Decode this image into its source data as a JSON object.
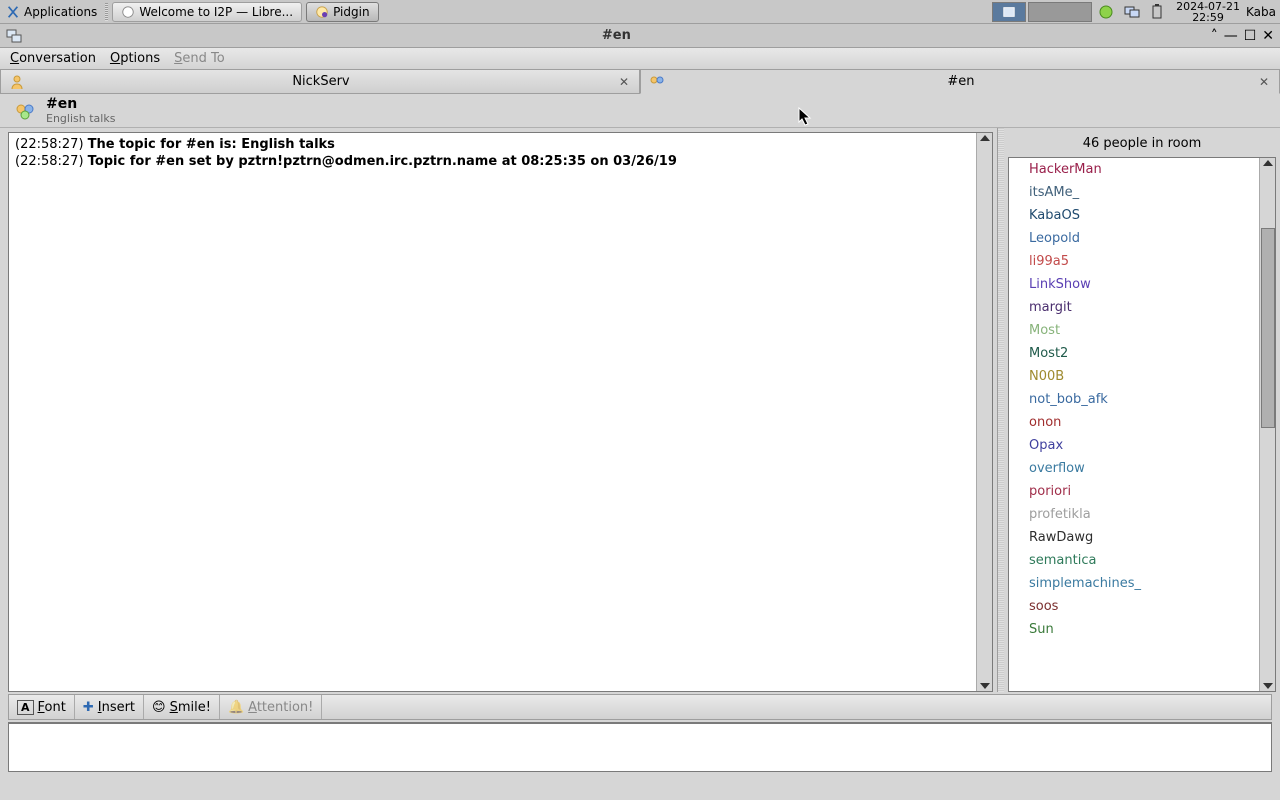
{
  "panel": {
    "apps_label": "Applications",
    "tasks": [
      {
        "label": "Welcome to I2P — Libre..."
      },
      {
        "label": "Pidgin"
      }
    ],
    "clock_date": "2024-07-21",
    "clock_time": "22:59",
    "user": "Kaba"
  },
  "window": {
    "title": "#en",
    "min": "▾",
    "max": "▴",
    "close": "✕",
    "rollup": "▴",
    "rolldown": "▾"
  },
  "menu": {
    "conversation": "Conversation",
    "options": "Options",
    "sendto": "Send To"
  },
  "tabs": [
    {
      "label": "NickServ",
      "active": false
    },
    {
      "label": "#en",
      "active": true
    }
  ],
  "channel": {
    "name": "#en",
    "subtitle": "English talks"
  },
  "messages": [
    {
      "ts": "(22:58:27)",
      "text": "The topic for #en is: English talks"
    },
    {
      "ts": "(22:58:27)",
      "text": "Topic for #en set by pztrn!pztrn@odmen.irc.pztrn.name at 08:25:35 on 03/26/19"
    }
  ],
  "userlist": {
    "header": "46 people in room",
    "users": [
      {
        "n": "HackerMan",
        "c": "#991f4a"
      },
      {
        "n": "itsAMe_",
        "c": "#40607a"
      },
      {
        "n": "KabaOS",
        "c": "#1f4a6e"
      },
      {
        "n": "Leopold",
        "c": "#3a6aa0"
      },
      {
        "n": "li99a5",
        "c": "#c24a4a"
      },
      {
        "n": "LinkShow",
        "c": "#5a3fb3"
      },
      {
        "n": "margit",
        "c": "#4a2e6e"
      },
      {
        "n": "Most",
        "c": "#87b37a"
      },
      {
        "n": "Most2",
        "c": "#1f5a4a"
      },
      {
        "n": "N00B",
        "c": "#9e8a2e"
      },
      {
        "n": "not_bob_afk",
        "c": "#3a6aa0"
      },
      {
        "n": "onon",
        "c": "#a02e2e"
      },
      {
        "n": "Opax",
        "c": "#3f3f9e"
      },
      {
        "n": "overflow",
        "c": "#3a7aa0"
      },
      {
        "n": "poriori",
        "c": "#a02e4a"
      },
      {
        "n": "profetikla",
        "c": "#9e9e9e"
      },
      {
        "n": "RawDawg",
        "c": "#2e2e2e"
      },
      {
        "n": "semantica",
        "c": "#2e7a5a"
      },
      {
        "n": "simplemachines_",
        "c": "#3a7aa0"
      },
      {
        "n": "soos",
        "c": "#7a2e2e"
      },
      {
        "n": "Sun",
        "c": "#3a7a3a"
      }
    ]
  },
  "toolbar": {
    "font": "Font",
    "insert": "Insert",
    "smile": "Smile!",
    "attention": "Attention!"
  }
}
